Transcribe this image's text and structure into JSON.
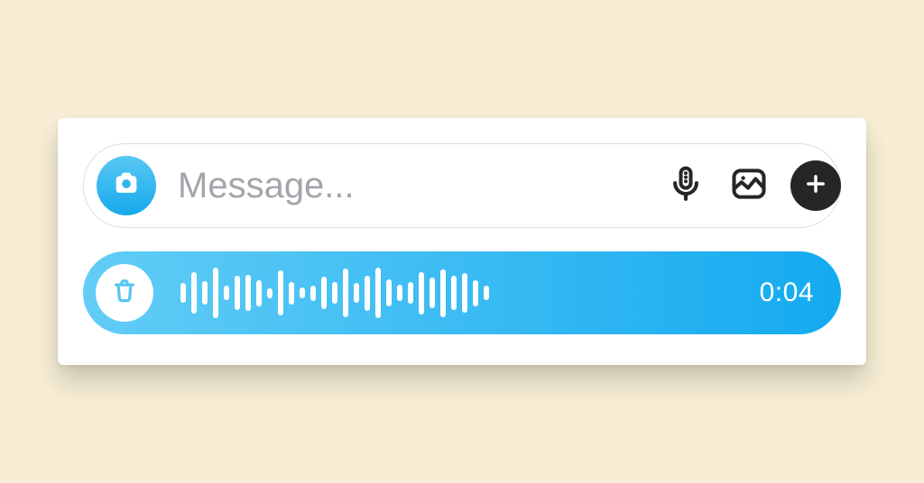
{
  "composer": {
    "placeholder": "Message..."
  },
  "voice": {
    "duration_label": "0:04",
    "waveform_heights_pct": [
      40,
      82,
      46,
      100,
      28,
      68,
      72,
      52,
      20,
      90,
      44,
      22,
      30,
      64,
      42,
      96,
      40,
      70,
      100,
      54,
      32,
      42,
      84,
      60,
      94,
      68,
      78,
      52,
      28
    ]
  }
}
